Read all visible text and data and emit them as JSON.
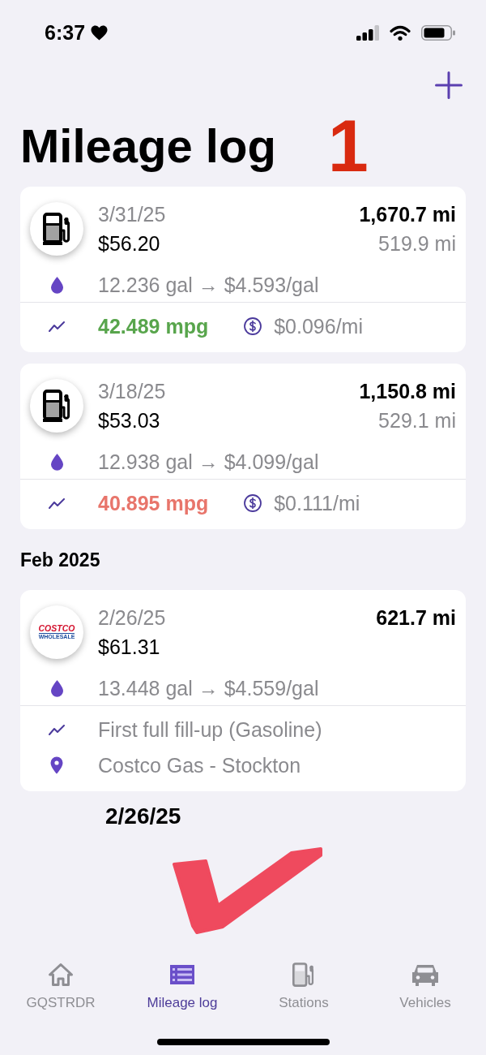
{
  "status_bar": {
    "time": "6:37"
  },
  "header": {
    "title": "Mileage log",
    "mark": "1"
  },
  "sections": [
    {
      "entries": [
        {
          "logo": {
            "kind": "pump"
          },
          "date": "3/31/25",
          "cost": "$56.20",
          "odometer": "1,670.7 mi",
          "distance": "519.9 mi",
          "fuel": "12.236 gal → $4.593/gal",
          "rows": [
            {
              "kind": "mpg",
              "mpg": "42.489 mpg",
              "color": "#58a54c",
              "per_mile": "$0.096/mi"
            }
          ]
        },
        {
          "logo": {
            "kind": "pump"
          },
          "date": "3/18/25",
          "cost": "$53.03",
          "odometer": "1,150.8 mi",
          "distance": "529.1 mi",
          "fuel": "12.938 gal → $4.099/gal",
          "rows": [
            {
              "kind": "mpg",
              "mpg": "40.895 mpg",
              "color": "#e8756b",
              "per_mile": "$0.111/mi"
            }
          ]
        }
      ]
    },
    {
      "heading": "Feb 2025",
      "entries": [
        {
          "logo": {
            "kind": "brand",
            "name": "COSTCO",
            "subtitle": "WHOLESALE"
          },
          "date": "2/26/25",
          "cost": "$61.31",
          "odometer": "621.7 mi",
          "fuel": "13.448 gal → $4.559/gal",
          "rows": [
            {
              "kind": "note",
              "text": "First full fill-up (Gasoline)"
            },
            {
              "kind": "location",
              "text": "Costco Gas - Stockton"
            }
          ]
        }
      ]
    }
  ],
  "annotation": {
    "text": "2/26/25"
  },
  "tabs": [
    {
      "label": "GQSTRDR",
      "kind": "home",
      "selected": false
    },
    {
      "label": "Mileage log",
      "kind": "list",
      "selected": true
    },
    {
      "label": "Stations",
      "kind": "pump",
      "selected": false
    },
    {
      "label": "Vehicles",
      "kind": "car",
      "selected": false
    }
  ]
}
